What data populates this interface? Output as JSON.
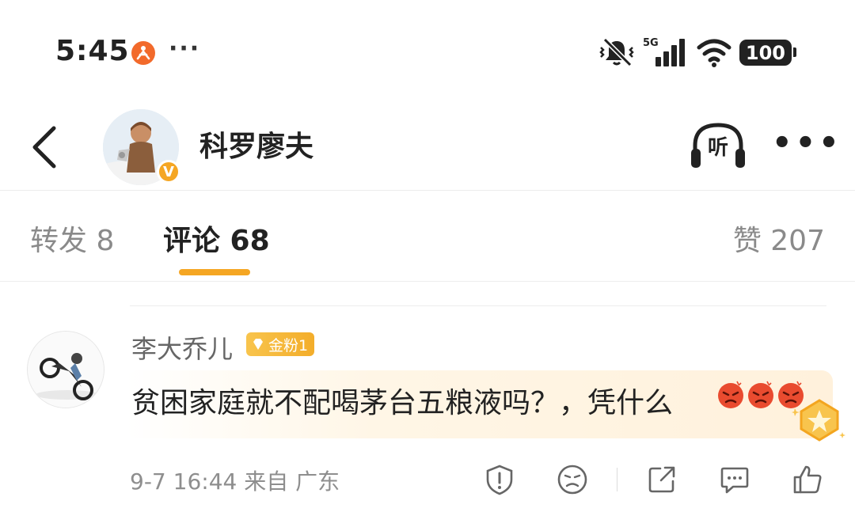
{
  "status_bar": {
    "time": "5:45",
    "more": "···",
    "network": "5G",
    "battery": "100",
    "icons": [
      "app-notification-icon",
      "mute-vibrate-icon",
      "signal-icon",
      "wifi-icon",
      "battery-icon"
    ]
  },
  "header": {
    "user_name": "科罗廖夫",
    "listen_label": "听",
    "more": "•••",
    "verified_badge": "V"
  },
  "tabs": {
    "repost": "转发 8",
    "comment": "评论 68",
    "like": "赞 207",
    "active": "comment",
    "accent_color": "#f5a623"
  },
  "comment": {
    "author": "李大乔儿",
    "fan_badge": "金粉1",
    "text": "贫困家庭就不配喝茅台五粮液吗？，凭什么",
    "emojis": [
      "angry-emoji",
      "angry-emoji",
      "angry-emoji"
    ],
    "time": "9-7 16:44",
    "source": "来自 广东",
    "actions": [
      "report-icon",
      "dislike-face-icon",
      "share-icon",
      "comment-icon",
      "like-icon"
    ]
  }
}
